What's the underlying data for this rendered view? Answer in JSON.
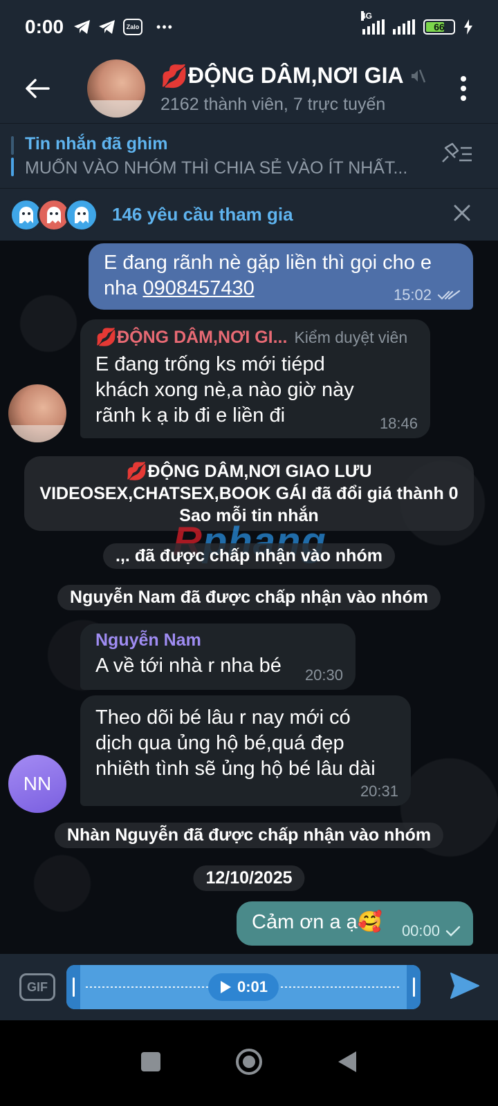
{
  "status_bar": {
    "time": "0:00",
    "network": "4G",
    "battery_level": "66",
    "apps": [
      "telegram-icon",
      "telegram-icon",
      "zalo-icon"
    ],
    "zalo_label": "Zalo",
    "more": "•••"
  },
  "header": {
    "title_emoji": "💋",
    "title": "ĐỘNG DÂM,NƠI GIA",
    "subtitle": "2162 thành viên, 7 trực tuyến"
  },
  "pinned": {
    "label": "Tin nhắn đã ghim",
    "message": "MUỐN VÀO NHÓM THÌ CHIA SẺ VÀO ÍT NHẤT..."
  },
  "join_requests": {
    "text": "146 yêu cầu tham gia",
    "avatar_colors": [
      "#3fa6e8",
      "#e0645a",
      "#3fa6e8"
    ]
  },
  "messages": [
    {
      "type": "outgoing",
      "line1": "E đang rãnh nè gặp liền thì gọi cho e",
      "line2_prefix": "nha ",
      "phone": "0908457430",
      "time": "15:02"
    },
    {
      "type": "incoming",
      "sender": "💋ĐỘNG DÂM,NƠI GI...",
      "sender_color": "#e86a74",
      "role": "Kiểm duyệt viên",
      "lines": [
        "E đang trống ks mới tiépd",
        "khách xong nè,a nào giờ này",
        "rãnh k ạ ib đi e liền đi"
      ],
      "time": "18:46"
    },
    {
      "type": "service",
      "lines": [
        "💋ĐỘNG DÂM,NƠI GIAO LƯU",
        "VIDEOSEX,CHATSEX,BOOK GÁI đã đổi giá thành 0",
        "Sao mỗi tin nhắn"
      ]
    },
    {
      "type": "service",
      "text": ".,. đã được chấp nhận vào nhóm"
    },
    {
      "type": "service",
      "text": "Nguyễn Nam đã được chấp nhận vào nhóm"
    },
    {
      "type": "incoming",
      "sender": "Nguyễn Nam",
      "sender_color": "#9f8cf2",
      "text": "A về tới nhà r nha bé",
      "time": "20:30"
    },
    {
      "type": "incoming",
      "avatar_initials": "NN",
      "lines": [
        "Theo dõi bé lâu r nay mới có",
        "dịch qua ủng hộ bé,quá đẹp",
        "nhiêth tình sẽ ủng hộ bé lâu dài"
      ],
      "time": "20:31"
    },
    {
      "type": "service",
      "text": "Nhàn Nguyễn đã được chấp nhận vào nhóm"
    },
    {
      "type": "date",
      "text": "12/10/2025"
    },
    {
      "type": "outgoing",
      "text": "Cảm ơn a ạ🥰",
      "time": "00:00"
    }
  ],
  "watermark": {
    "part1": "R",
    "part2": "phang"
  },
  "input_bar": {
    "gif_label": "GIF",
    "voice_duration": "0:01"
  },
  "colors": {
    "header_bg": "#1d2733",
    "accent": "#5fb4ef",
    "outgoing_bubble": "#4e6fa8",
    "incoming_bubble": "#1e2328"
  }
}
